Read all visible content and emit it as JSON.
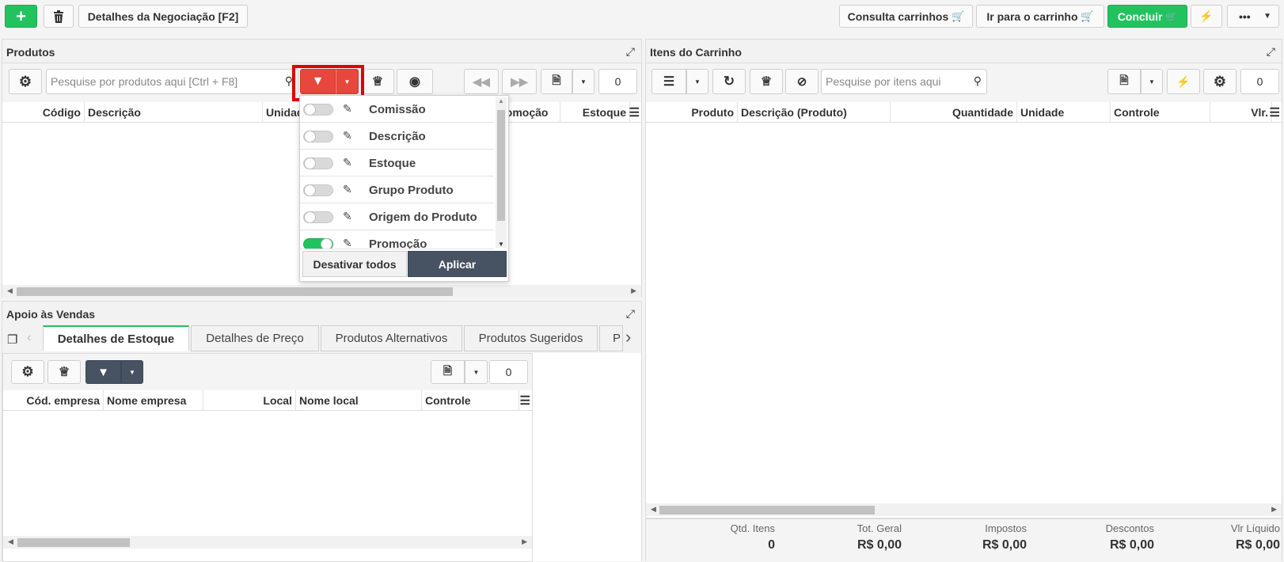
{
  "topbar": {
    "add_label": "+",
    "deal_details": "Detalhes da Negociação [F2]",
    "consult_carts": "Consulta carrinhos",
    "go_to_cart": "Ir para o carrinho",
    "conclude": "Concluir"
  },
  "products": {
    "title": "Produtos",
    "search_placeholder": "Pesquise por produtos aqui [Ctrl + F8]",
    "count": "0",
    "columns": [
      "Código",
      "Descrição",
      "Unidade",
      "Promoção",
      "Estoque"
    ]
  },
  "filter_menu": {
    "items": [
      {
        "label": "Comissão",
        "enabled": false
      },
      {
        "label": "Descrição",
        "enabled": false
      },
      {
        "label": "Estoque",
        "enabled": false
      },
      {
        "label": "Grupo Produto",
        "enabled": false
      },
      {
        "label": "Origem do Produto",
        "enabled": false
      },
      {
        "label": "Promoção",
        "enabled": true
      }
    ],
    "disable_all": "Desativar todos",
    "apply": "Aplicar"
  },
  "cart": {
    "title": "Itens do Carrinho",
    "search_placeholder": "Pesquise por itens aqui",
    "count": "0",
    "columns": [
      "Produto",
      "Descrição (Produto)",
      "Quantidade",
      "Unidade",
      "Controle",
      "Vlr."
    ],
    "totals": [
      {
        "label": "Qtd. Itens",
        "value": "0"
      },
      {
        "label": "Tot. Geral",
        "value": "R$ 0,00"
      },
      {
        "label": "Impostos",
        "value": "R$ 0,00"
      },
      {
        "label": "Descontos",
        "value": "R$ 0,00"
      },
      {
        "label": "Vlr Líquido",
        "value": "R$ 0,00"
      }
    ]
  },
  "sales_support": {
    "title": "Apoio às Vendas",
    "tabs": [
      "Detalhes de Estoque",
      "Detalhes de Preço",
      "Produtos Alternativos",
      "Produtos Sugeridos",
      "P"
    ],
    "count": "0",
    "columns": [
      "Cód. empresa",
      "Nome empresa",
      "Local",
      "Nome local",
      "Controle"
    ]
  },
  "colors": {
    "accent_green": "#22c35e",
    "filter_red": "#e8473d",
    "highlight_red": "#e00000",
    "dark_button": "#475262"
  }
}
